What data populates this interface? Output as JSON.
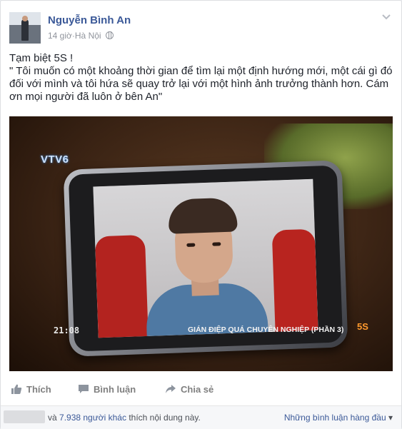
{
  "post": {
    "author_name": "Nguyễn Bình An",
    "time": "14 giờ",
    "separator": " · ",
    "location": "Hà Nội",
    "text_line1": "Tạm biệt 5S !",
    "text_line2": "\" Tôi muốn có một khoảng thời gian để tìm lại một định hướng mới, một cái gì đó đối với mình và tôi hứa sẽ quay trở lại với một hình ảnh trưởng thành hơn. Cám ơn mọi người đã luôn ở bên An\""
  },
  "media": {
    "channel_logo": "VTV6",
    "timecode": "21:08",
    "caption": "GIÁN ĐIỆP QUÁ CHUYÊN NGHIỆP (PHẦN 3)",
    "brand_logo": "5S"
  },
  "actions": {
    "like_label": "Thích",
    "comment_label": "Bình luận",
    "share_label": "Chia sẻ"
  },
  "footer": {
    "likes_prefix": "và ",
    "likes_count_link": "7.938 người khác",
    "likes_suffix": " thích nội dung này.",
    "comments_order": "Những bình luận hàng đầu",
    "comments_order_arrow": " ▾"
  },
  "icons": {
    "globe": "globe-icon",
    "chevron": "chevron-down-icon",
    "like": "thumbs-up-icon",
    "comment": "comment-icon",
    "share": "share-arrow-icon"
  },
  "colors": {
    "link": "#3b5998",
    "action": "#7f7f7f",
    "meta": "#90949c"
  }
}
